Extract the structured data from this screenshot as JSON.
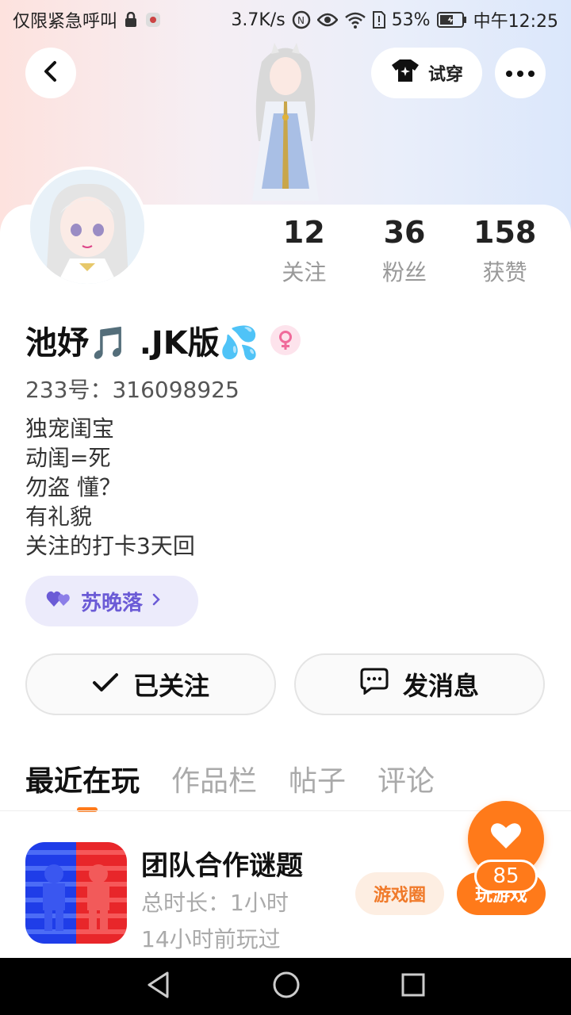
{
  "status_bar": {
    "carrier": "仅限紧急呼叫",
    "net_speed": "3.7K/s",
    "battery": "53%",
    "time": "中午12:25"
  },
  "top": {
    "tryon_label": "试穿"
  },
  "profile": {
    "stats": [
      {
        "value": "12",
        "label": "关注"
      },
      {
        "value": "36",
        "label": "粉丝"
      },
      {
        "value": "158",
        "label": "获赞"
      }
    ],
    "name": "池妤🎵 .JK版💦",
    "uid": "233号：316098925",
    "bio": [
      "独宠闺宝",
      "动闺=死",
      "勿盗 懂？",
      "有礼貌",
      "关注的打卡3天回"
    ],
    "cp_tag": "苏晚落"
  },
  "actions": {
    "follow_label": "已关注",
    "message_label": "发消息"
  },
  "tabs": [
    {
      "label": "最近在玩",
      "active": true
    },
    {
      "label": "作品栏",
      "active": false
    },
    {
      "label": "帖子",
      "active": false
    },
    {
      "label": "评论",
      "active": false
    }
  ],
  "game": {
    "title": "团队合作谜题",
    "duration": "总时长：1小时",
    "last_played": "14小时前玩过",
    "circle_label": "游戏圈",
    "play_label": "玩游戏"
  },
  "like": {
    "count": "85"
  },
  "colors": {
    "accent": "#ff7a1a",
    "cp_purple": "#6b5bd6"
  }
}
